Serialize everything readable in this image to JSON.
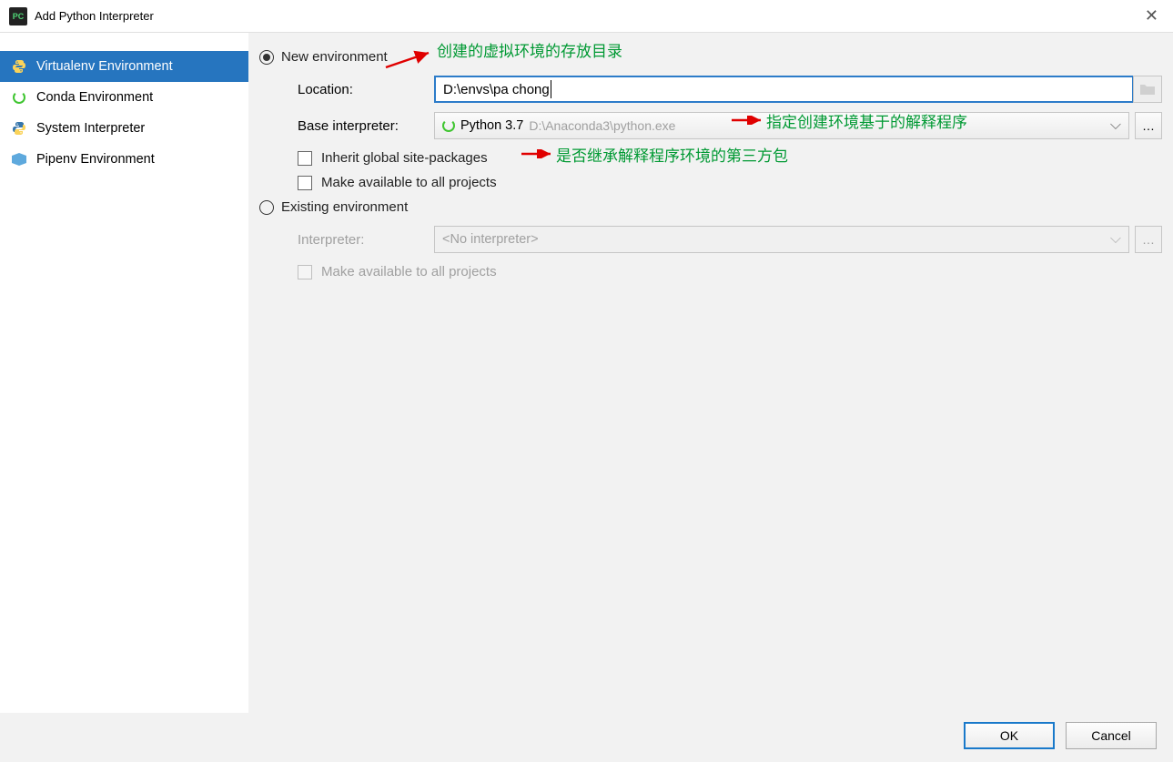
{
  "title": "Add Python Interpreter",
  "sidebar": {
    "items": [
      {
        "label": "Virtualenv Environment",
        "selected": true
      },
      {
        "label": "Conda Environment",
        "selected": false
      },
      {
        "label": "System Interpreter",
        "selected": false
      },
      {
        "label": "Pipenv Environment",
        "selected": false
      }
    ]
  },
  "form": {
    "newEnvLabel": "New environment",
    "locationLabel": "Location:",
    "locationValue": "D:\\envs\\pa chong",
    "baseInterpLabel": "Base interpreter:",
    "baseInterpValue": "Python 3.7",
    "baseInterpPath": "D:\\Anaconda3\\python.exe",
    "inheritLabel": "Inherit global site-packages",
    "availableAllLabel": "Make available to all projects",
    "existingEnvLabel": "Existing environment",
    "interpreterLabel": "Interpreter:",
    "interpreterValue": "<No interpreter>",
    "availableAll2Label": "Make available to all projects"
  },
  "annotations": {
    "ann1": "创建的虚拟环境的存放目录",
    "ann2": "指定创建环境基于的解释程序",
    "ann3": "是否继承解释程序环境的第三方包"
  },
  "buttons": {
    "ok": "OK",
    "cancel": "Cancel"
  }
}
